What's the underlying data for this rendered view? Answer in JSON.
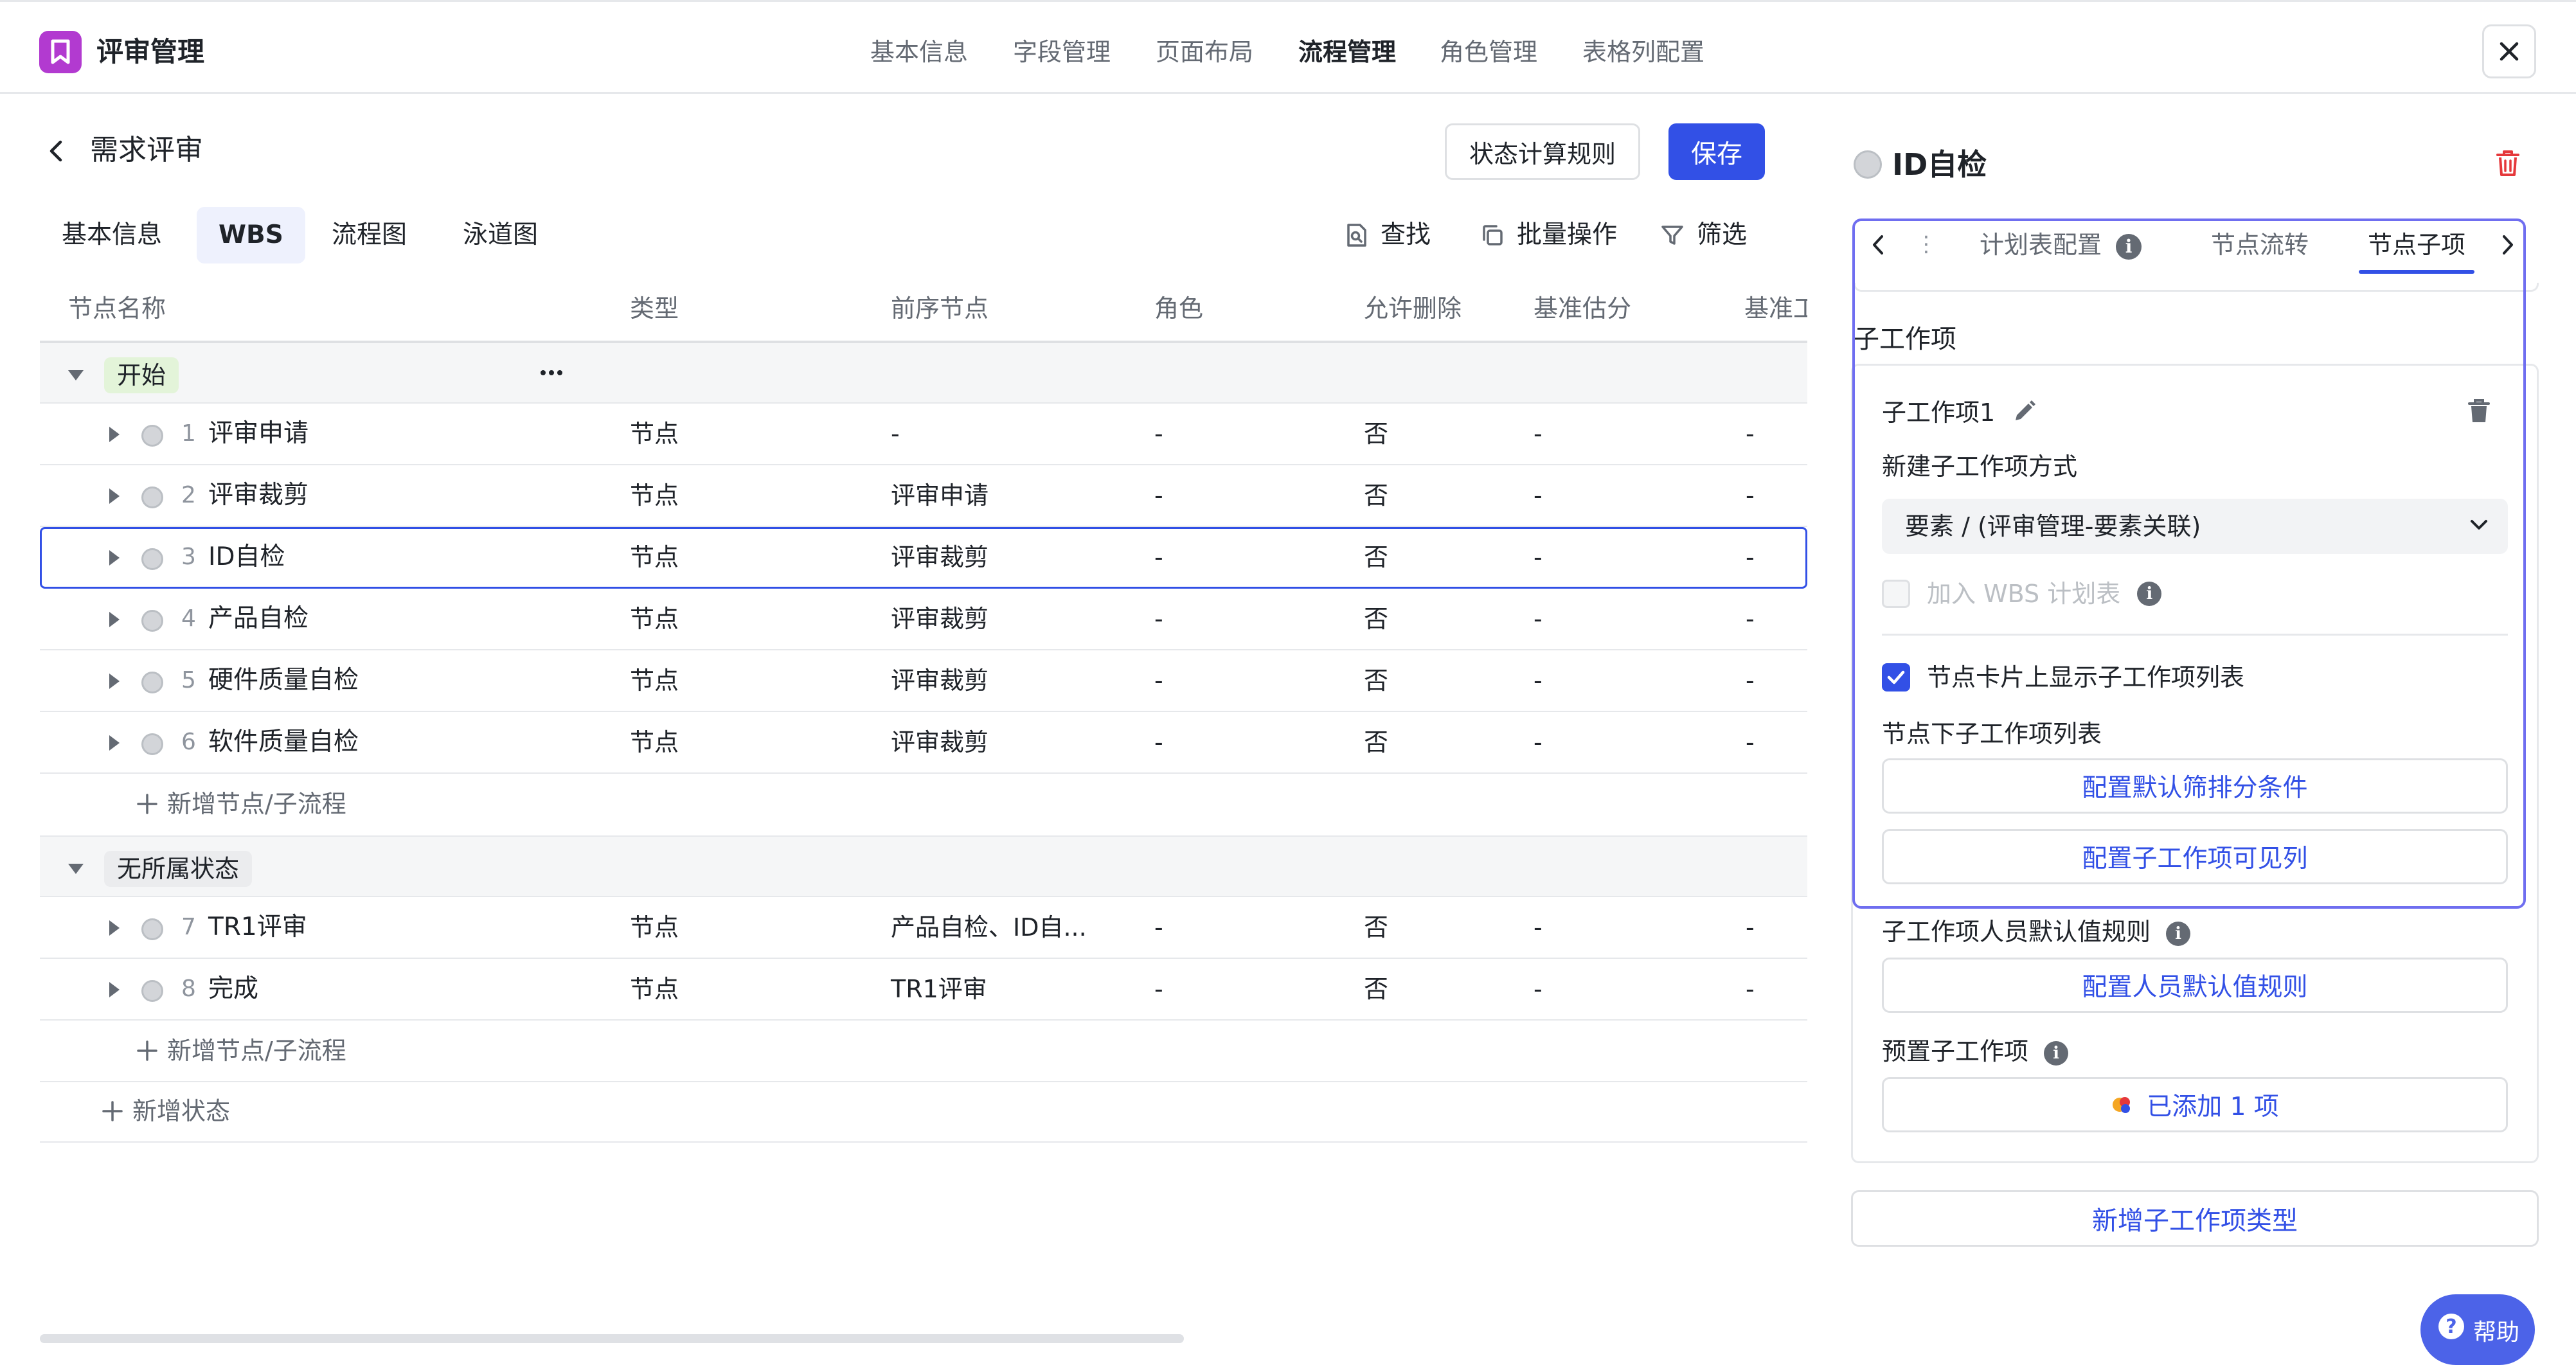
{
  "app": {
    "title": "评审管理"
  },
  "top_tabs": [
    {
      "label": "基本信息"
    },
    {
      "label": "字段管理"
    },
    {
      "label": "页面布局"
    },
    {
      "label": "流程管理"
    },
    {
      "label": "角色管理"
    },
    {
      "label": "表格列配置"
    }
  ],
  "active_top_tab": "流程管理",
  "page": {
    "title": "需求评审",
    "rule_button": "状态计算规则",
    "save_button": "保存"
  },
  "sub_tabs": [
    {
      "label": "基本信息"
    },
    {
      "label": "WBS"
    },
    {
      "label": "流程图"
    },
    {
      "label": "泳道图"
    }
  ],
  "active_sub_tab": "WBS",
  "tools": {
    "find": "查找",
    "batch": "批量操作",
    "filter": "筛选"
  },
  "table": {
    "columns": [
      "节点名称",
      "类型",
      "前序节点",
      "角色",
      "允许删除",
      "基准估分",
      "基准工"
    ],
    "groups": [
      {
        "tag": "开始",
        "tag_color": "#e3f4d9",
        "rows": [
          {
            "num": "1",
            "name": "评审申请",
            "type": "节点",
            "prev": "-",
            "role": "-",
            "deletable": "否",
            "estimate": "-",
            "base": "-"
          },
          {
            "num": "2",
            "name": "评审裁剪",
            "type": "节点",
            "prev": "评审申请",
            "role": "-",
            "deletable": "否",
            "estimate": "-",
            "base": "-"
          },
          {
            "num": "3",
            "name": "ID自检",
            "type": "节点",
            "prev": "评审裁剪",
            "role": "-",
            "deletable": "否",
            "estimate": "-",
            "base": "-"
          },
          {
            "num": "4",
            "name": "产品自检",
            "type": "节点",
            "prev": "评审裁剪",
            "role": "-",
            "deletable": "否",
            "estimate": "-",
            "base": "-"
          },
          {
            "num": "5",
            "name": "硬件质量自检",
            "type": "节点",
            "prev": "评审裁剪",
            "role": "-",
            "deletable": "否",
            "estimate": "-",
            "base": "-"
          },
          {
            "num": "6",
            "name": "软件质量自检",
            "type": "节点",
            "prev": "评审裁剪",
            "role": "-",
            "deletable": "否",
            "estimate": "-",
            "base": "-"
          }
        ],
        "add_label": "新增节点/子流程"
      },
      {
        "tag": "无所属状态",
        "tag_color": "#ebecee",
        "rows": [
          {
            "num": "7",
            "name": "TR1评审",
            "type": "节点",
            "prev": "产品自检、ID自...",
            "role": "-",
            "deletable": "否",
            "estimate": "-",
            "base": "-"
          },
          {
            "num": "8",
            "name": "完成",
            "type": "节点",
            "prev": "TR1评审",
            "role": "-",
            "deletable": "否",
            "estimate": "-",
            "base": "-"
          }
        ],
        "add_label": "新增节点/子流程"
      }
    ],
    "add_state_label": "新增状态",
    "selected_row": "ID自检"
  },
  "panel": {
    "title": "ID自检",
    "tabs": [
      {
        "label": "计划表配置"
      },
      {
        "label": "节点流转"
      },
      {
        "label": "节点子项"
      }
    ],
    "active_tab": "节点子项",
    "section_title": "子工作项",
    "item_name": "子工作项1",
    "create_mode_label": "新建子工作项方式",
    "create_mode_value": "要素 / (评审管理-要素关联)",
    "add_wbs_label": "加入 WBS 计划表",
    "add_wbs_checked": false,
    "show_list_label": "节点卡片上显示子工作项列表",
    "show_list_checked": true,
    "list_label": "节点下子工作项列表",
    "btn_filter": "配置默认筛排分条件",
    "btn_columns": "配置子工作项可见列",
    "person_rule_label": "子工作项人员默认值规则",
    "btn_person_rule": "配置人员默认值规则",
    "preset_label": "预置子工作项",
    "btn_preset": "已添加 1 项",
    "new_type_button": "新增子工作项类型"
  },
  "help": {
    "label": "帮助"
  },
  "colors": {
    "primary": "#3250e6",
    "logo": "#b23ad0",
    "danger": "#e5383b",
    "highlight": "#6f6ef0"
  }
}
